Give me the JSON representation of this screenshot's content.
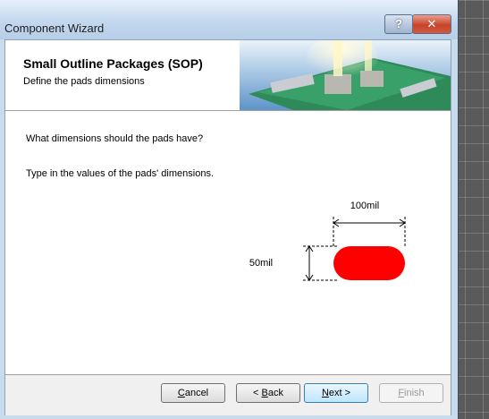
{
  "window": {
    "title": "Component Wizard"
  },
  "titlebar": {
    "help_label": "?",
    "close_label": "✕"
  },
  "header": {
    "title": "Small Outline Packages (SOP)",
    "subtitle": "Define the pads dimensions"
  },
  "content": {
    "question": "What dimensions should the pads have?",
    "instruction": "Type in the values of the pads' dimensions.",
    "pad_width": "100mil",
    "pad_height": "50mil",
    "pad_color": "#ff0000"
  },
  "buttons": {
    "cancel": {
      "accel": "C",
      "rest": "ancel"
    },
    "back": {
      "prefix": "< ",
      "accel": "B",
      "rest": "ack"
    },
    "next": {
      "accel": "N",
      "rest": "ext >"
    },
    "finish": {
      "accel": "F",
      "rest": "inish"
    }
  }
}
